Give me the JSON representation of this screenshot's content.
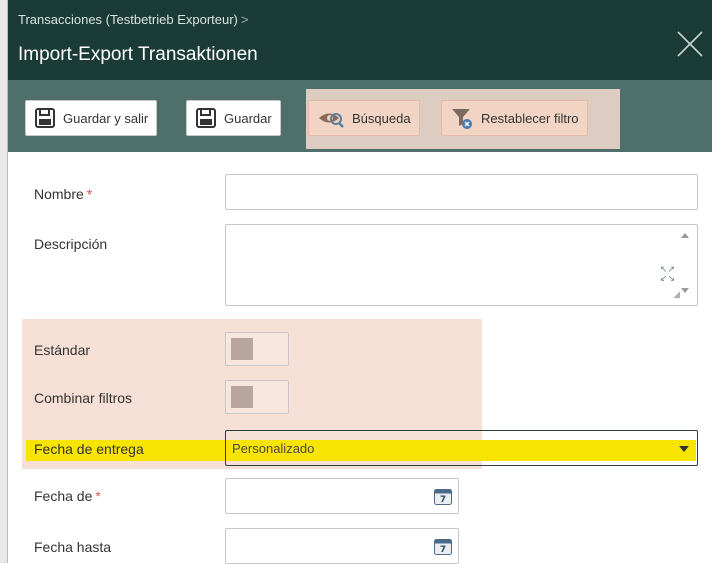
{
  "header": {
    "breadcrumb": "Transacciones (Testbetrieb Exporteur)",
    "breadcrumb_separator": ">",
    "title": "Import-Export Transaktionen",
    "close_icon": "close-icon"
  },
  "toolbar": {
    "save_exit_label": "Guardar y salir",
    "save_label": "Guardar",
    "search_label": "Búsqueda",
    "reset_filter_label": "Restablecer filtro"
  },
  "form": {
    "name_label": "Nombre",
    "required_mark": "*",
    "name_value": "",
    "description_label": "Descripción",
    "description_value": "",
    "standard_label": "Estándar",
    "standard_on": false,
    "combine_filters_label": "Combinar filtros",
    "combine_filters_on": false,
    "delivery_date_label": "Fecha de entrega",
    "delivery_date_value": "Personalizado",
    "date_from_label": "Fecha de",
    "date_from_value": "",
    "date_to_label": "Fecha hasta",
    "date_to_value": ""
  },
  "colors": {
    "header_bg": "#1b3b37",
    "toolbar_bg": "#4f6f6b",
    "highlight_peach": "#f5ddd0",
    "highlight_yellow": "#f7e400",
    "required_red": "#d9534f"
  }
}
